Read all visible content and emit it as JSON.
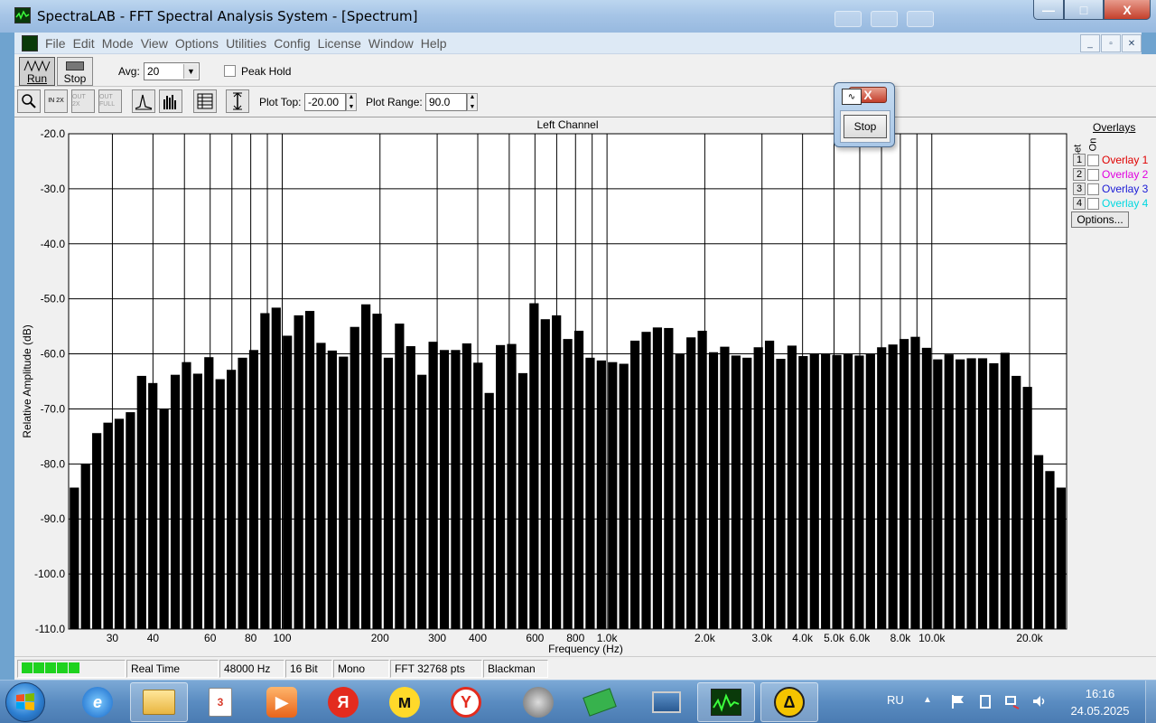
{
  "window": {
    "title": "SpectraLAB - FFT Spectral Analysis System - [Spectrum]",
    "controls": [
      "—",
      "□",
      "X"
    ]
  },
  "menu": {
    "items": [
      "File",
      "Edit",
      "Mode",
      "View",
      "Options",
      "Utilities",
      "Config",
      "License",
      "Window",
      "Help"
    ]
  },
  "toolbar": {
    "run_label": "Run",
    "stop_label": "Stop",
    "avg_label": "Avg:",
    "avg_value": "20",
    "peak_hold_label": "Peak Hold",
    "plot_top_label": "Plot Top:",
    "plot_top_value": "-20.00",
    "plot_range_label": "Plot Range:",
    "plot_range_value": "90.0",
    "zoom_buttons": [
      "IN 2X",
      "OUT 2X",
      "OUT FULL"
    ]
  },
  "overlays": {
    "header": "Overlays",
    "set_label": "Set",
    "on_label": "On",
    "items": [
      {
        "num": "1",
        "label": "Overlay 1",
        "color": "#e00000"
      },
      {
        "num": "2",
        "label": "Overlay 2",
        "color": "#e000e0"
      },
      {
        "num": "3",
        "label": "Overlay 3",
        "color": "#1a1ad6"
      },
      {
        "num": "4",
        "label": "Overlay 4",
        "color": "#00d8e0"
      }
    ],
    "options_label": "Options..."
  },
  "stop_dialog": {
    "button_label": "Stop"
  },
  "status": {
    "mode": "Real Time",
    "sample_rate": "48000 Hz",
    "bits": "16 Bit",
    "channels": "Mono",
    "fft": "FFT 32768 pts",
    "window": "Blackman",
    "level_leds": 5
  },
  "taskbar": {
    "lang": "RU",
    "time": "16:16",
    "date": "24.05.2025"
  },
  "chart_data": {
    "type": "bar",
    "title": "Left Channel",
    "xlabel": "Frequency (Hz)",
    "ylabel": "Relative Amplitude (dB)",
    "x_scale": "log",
    "xlim": [
      22,
      26000
    ],
    "ylim": [
      -110,
      -20
    ],
    "grid": true,
    "y_ticks": [
      "-20.0",
      "-30.0",
      "-40.0",
      "-50.0",
      "-60.0",
      "-70.0",
      "-80.0",
      "-90.0",
      "-100.0",
      "-110.0"
    ],
    "x_ticks": [
      {
        "f": 30,
        "label": "30"
      },
      {
        "f": 40,
        "label": "40"
      },
      {
        "f": 60,
        "label": "60"
      },
      {
        "f": 80,
        "label": "80"
      },
      {
        "f": 100,
        "label": "100"
      },
      {
        "f": 200,
        "label": "200"
      },
      {
        "f": 300,
        "label": "300"
      },
      {
        "f": 400,
        "label": "400"
      },
      {
        "f": 600,
        "label": "600"
      },
      {
        "f": 800,
        "label": "800"
      },
      {
        "f": 1000,
        "label": "1.0k"
      },
      {
        "f": 2000,
        "label": "2.0k"
      },
      {
        "f": 3000,
        "label": "3.0k"
      },
      {
        "f": 4000,
        "label": "4.0k"
      },
      {
        "f": 5000,
        "label": "5.0k"
      },
      {
        "f": 6000,
        "label": "6.0k"
      },
      {
        "f": 8000,
        "label": "8.0k"
      },
      {
        "f": 10000,
        "label": "10.0k"
      },
      {
        "f": 20000,
        "label": "20.0k"
      }
    ],
    "grid_freqs": [
      30,
      40,
      50,
      60,
      70,
      80,
      90,
      100,
      200,
      300,
      400,
      500,
      600,
      700,
      800,
      900,
      1000,
      2000,
      3000,
      4000,
      5000,
      6000,
      7000,
      8000,
      9000,
      10000,
      20000
    ],
    "values": [
      -84.3,
      -80.0,
      -74.4,
      -72.5,
      -71.8,
      -70.6,
      -64.0,
      -65.3,
      -70.0,
      -63.8,
      -61.5,
      -63.6,
      -60.6,
      -64.6,
      -62.9,
      -60.7,
      -59.3,
      -52.6,
      -51.6,
      -56.7,
      -53.0,
      -52.2,
      -58.0,
      -59.4,
      -60.5,
      -55.1,
      -51.0,
      -52.7,
      -60.7,
      -54.5,
      -58.6,
      -63.8,
      -57.8,
      -59.3,
      -59.3,
      -58.1,
      -61.6,
      -67.1,
      -58.4,
      -58.2,
      -63.5,
      -50.8,
      -53.7,
      -53.0,
      -57.3,
      -55.8,
      -60.7,
      -61.2,
      -61.5,
      -61.8,
      -57.6,
      -56.0,
      -55.2,
      -55.3,
      -60.0,
      -57.0,
      -55.8,
      -59.7,
      -58.7,
      -60.3,
      -60.7,
      -58.8,
      -57.6,
      -60.9,
      -58.5,
      -60.4,
      -59.9,
      -60.0,
      -60.2,
      -59.9,
      -60.3,
      -60.0,
      -58.8,
      -58.3,
      -57.3,
      -56.9,
      -58.9,
      -61.0,
      -60.1,
      -61.0,
      -60.8,
      -60.8,
      -61.7,
      -59.8,
      -64.0,
      -66.0,
      -78.4,
      -81.3,
      -84.3
    ]
  }
}
